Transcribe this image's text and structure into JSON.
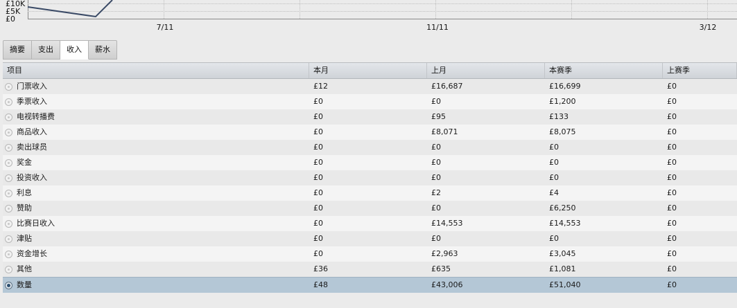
{
  "chart": {
    "y_ticks": [
      "£10K",
      "£5K",
      "£0"
    ],
    "x_ticks": [
      "7/11",
      "11/11",
      "3/12"
    ],
    "line_color": "#3a4a66"
  },
  "tabs": [
    {
      "label": "摘要",
      "active": false
    },
    {
      "label": "支出",
      "active": false
    },
    {
      "label": "收入",
      "active": true
    },
    {
      "label": "薪水",
      "active": false
    }
  ],
  "table": {
    "columns": [
      "项目",
      "本月",
      "上月",
      "本赛季",
      "上赛季"
    ],
    "rows": [
      [
        "门票收入",
        "£12",
        "£16,687",
        "£16,699",
        "£0"
      ],
      [
        "季票收入",
        "£0",
        "£0",
        "£1,200",
        "£0"
      ],
      [
        "电视转播费",
        "£0",
        "£95",
        "£133",
        "£0"
      ],
      [
        "商品收入",
        "£0",
        "£8,071",
        "£8,075",
        "£0"
      ],
      [
        "卖出球员",
        "£0",
        "£0",
        "£0",
        "£0"
      ],
      [
        "奖金",
        "£0",
        "£0",
        "£0",
        "£0"
      ],
      [
        "投资收入",
        "£0",
        "£0",
        "£0",
        "£0"
      ],
      [
        "利息",
        "£0",
        "£2",
        "£4",
        "£0"
      ],
      [
        "赞助",
        "£0",
        "£0",
        "£6,250",
        "£0"
      ],
      [
        "比赛日收入",
        "£0",
        "£14,553",
        "£14,553",
        "£0"
      ],
      [
        "津贴",
        "£0",
        "£0",
        "£0",
        "£0"
      ],
      [
        "资金增长",
        "£0",
        "£2,963",
        "£3,045",
        "£0"
      ],
      [
        "其他",
        "£36",
        "£635",
        "£1,081",
        "£0"
      ]
    ],
    "total": [
      "数量",
      "£48",
      "£43,006",
      "£51,040",
      "£0"
    ]
  }
}
